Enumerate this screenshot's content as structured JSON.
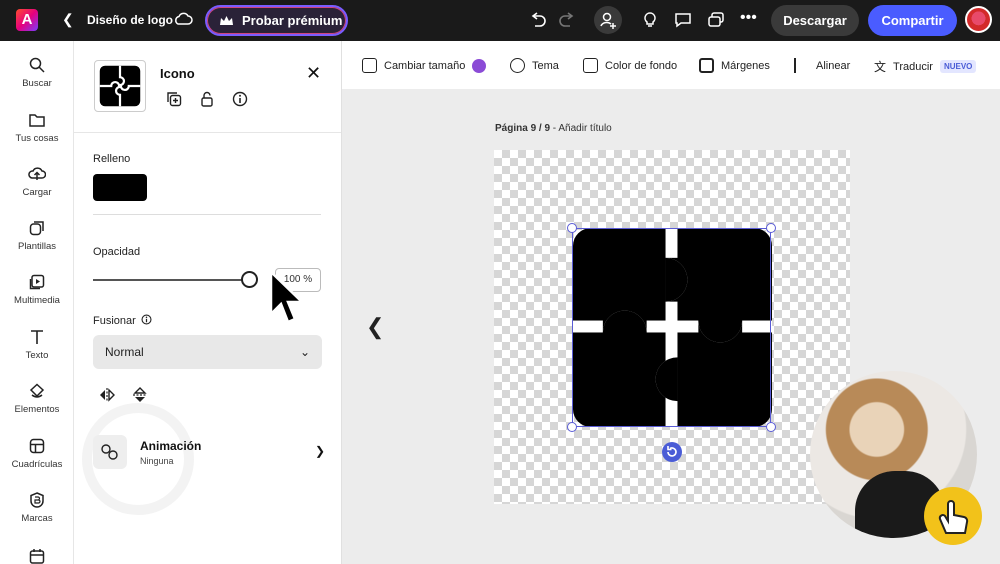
{
  "header": {
    "doc_title": "Diseño de logo",
    "premium_label": "Probar prémium",
    "download_label": "Descargar",
    "share_label": "Compartir",
    "icons": [
      "back-icon",
      "cloud-sync-icon",
      "crown-icon",
      "undo-icon",
      "redo-icon",
      "add-person-icon",
      "bulb-icon",
      "comment-icon",
      "present-icon",
      "more-icon"
    ]
  },
  "rail": {
    "items": [
      {
        "label": "Buscar",
        "icon": "search-icon"
      },
      {
        "label": "Tus cosas",
        "icon": "folder-icon"
      },
      {
        "label": "Cargar",
        "icon": "upload-cloud-icon"
      },
      {
        "label": "Plantillas",
        "icon": "templates-icon"
      },
      {
        "label": "Multimedia",
        "icon": "media-icon"
      },
      {
        "label": "Texto",
        "icon": "text-icon"
      },
      {
        "label": "Elementos",
        "icon": "elements-icon"
      },
      {
        "label": "Cuadrículas",
        "icon": "grid-icon"
      },
      {
        "label": "Marcas",
        "icon": "brand-icon"
      }
    ]
  },
  "panel": {
    "title": "Icono",
    "fill_label": "Relleno",
    "fill_color": "#000000",
    "opacity_label": "Opacidad",
    "opacity_value": "100 %",
    "opacity_fraction": 1.0,
    "blend_label": "Fusionar",
    "blend_value": "Normal",
    "animation_title": "Animación",
    "animation_value": "Ninguna"
  },
  "toolbar2": {
    "resize_label": "Cambiar tamaño",
    "theme_label": "Tema",
    "bg_color_label": "Color de fondo",
    "margins_label": "Márgenes",
    "align_label": "Alinear",
    "translate_label": "Traducir",
    "new_badge": "NUEVO"
  },
  "canvas": {
    "page_prefix": "Página 9 / 9",
    "page_suffix": " - Añadir título"
  },
  "colors": {
    "accent": "#4a5cff",
    "selection": "#5a5cd6",
    "topbar": "#1a1a1a"
  }
}
